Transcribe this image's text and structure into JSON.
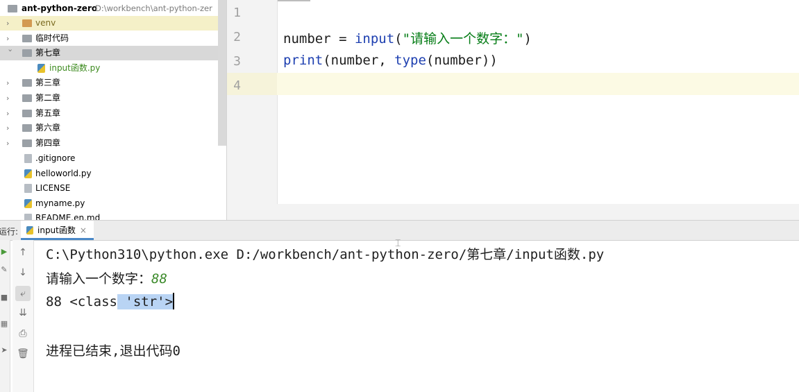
{
  "project": {
    "root_name": "ant-python-zero",
    "root_path": "D:\\workbench\\ant-python-zer",
    "items": [
      {
        "label": "venv"
      },
      {
        "label": "临时代码"
      },
      {
        "label": "第七章"
      },
      {
        "label": "input函数.py"
      },
      {
        "label": "第三章"
      },
      {
        "label": "第二章"
      },
      {
        "label": "第五章"
      },
      {
        "label": "第六章"
      },
      {
        "label": "第四章"
      },
      {
        "label": ".gitignore"
      },
      {
        "label": "helloworld.py"
      },
      {
        "label": "LICENSE"
      },
      {
        "label": "myname.py"
      },
      {
        "label": "README.en.md"
      }
    ]
  },
  "editor": {
    "line_numbers": [
      "1",
      "2",
      "3",
      "4"
    ],
    "line2": {
      "var": "number",
      "op": " = ",
      "fn": "input",
      "open": "(",
      "str": "\"请输入一个数字：\"",
      "close": ")"
    },
    "line3": {
      "fn": "print",
      "args_a": "(number, ",
      "fn2": "type",
      "args_b": "(number))"
    }
  },
  "run": {
    "label": "运行:",
    "tab_label": "input函数",
    "tab_close": "×"
  },
  "console": {
    "command": "C:\\Python310\\python.exe D:/workbench/ant-python-zero/第七章/input函数.py",
    "prompt": "请输入一个数字：",
    "input_value": "88",
    "output_plain": "88 <class",
    "output_selected": " 'str'>",
    "exit_message": "进程已结束,退出代码0"
  }
}
